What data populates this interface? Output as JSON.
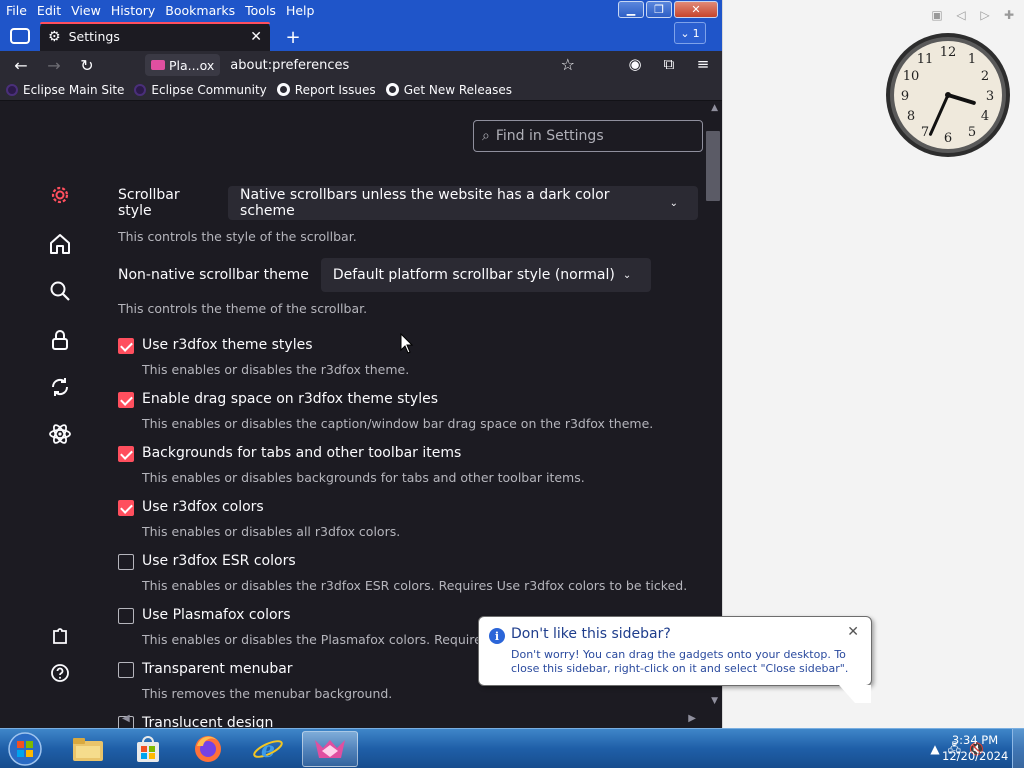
{
  "menu": [
    "File",
    "Edit",
    "View",
    "History",
    "Bookmarks",
    "Tools",
    "Help"
  ],
  "tab": {
    "title": "Settings",
    "count": "1"
  },
  "navbar": {
    "identity_label": "Pla...ox",
    "url": "about:preferences"
  },
  "bookmarks": [
    "Eclipse Main Site",
    "Eclipse Community",
    "Report Issues",
    "Get New Releases"
  ],
  "search": {
    "placeholder": "Find in Settings"
  },
  "settings": {
    "scrollbar_style_label": "Scrollbar style",
    "scrollbar_style_value": "Native scrollbars unless the website has a dark color scheme",
    "scrollbar_style_help": "This controls the style of the scrollbar.",
    "nonnative_label": "Non-native scrollbar theme",
    "nonnative_value": "Default platform scrollbar style (normal)",
    "nonnative_help": "This controls the theme of the scrollbar.",
    "options": [
      {
        "label": "Use r3dfox theme styles",
        "help": "This enables or disables the r3dfox theme.",
        "checked": true
      },
      {
        "label": "Enable drag space on r3dfox theme styles",
        "help": "This enables or disables the caption/window bar drag space on the r3dfox theme.",
        "checked": true
      },
      {
        "label": "Backgrounds for tabs and other toolbar items",
        "help": "This enables or disables backgrounds for tabs and other toolbar items.",
        "checked": true
      },
      {
        "label": "Use r3dfox colors",
        "help": "This enables or disables all r3dfox colors.",
        "checked": true
      },
      {
        "label": "Use r3dfox ESR colors",
        "help": "This enables or disables the r3dfox ESR colors. Requires Use r3dfox colors to be ticked.",
        "checked": false
      },
      {
        "label": "Use Plasmafox colors",
        "help": "This enables or disables the Plasmafox colors. Requires",
        "checked": false
      },
      {
        "label": "Transparent menubar",
        "help": "This removes the menubar background.",
        "checked": false
      },
      {
        "label": "Translucent design",
        "help": "",
        "checked": false
      }
    ]
  },
  "balloon": {
    "title": "Don't like this sidebar?",
    "body": "Don't worry! You can drag the gadgets onto your desktop. To close this sidebar, right-click on it and select \"Close sidebar\"."
  },
  "taskbar": {
    "time": "3:34 PM",
    "date": "12/20/2024"
  },
  "clock": {
    "hour": 3,
    "minute": 34
  },
  "colors": {
    "accent": "#ff4f5e",
    "content_bg": "#1c1b22",
    "titlebar": "#1f55c9"
  }
}
